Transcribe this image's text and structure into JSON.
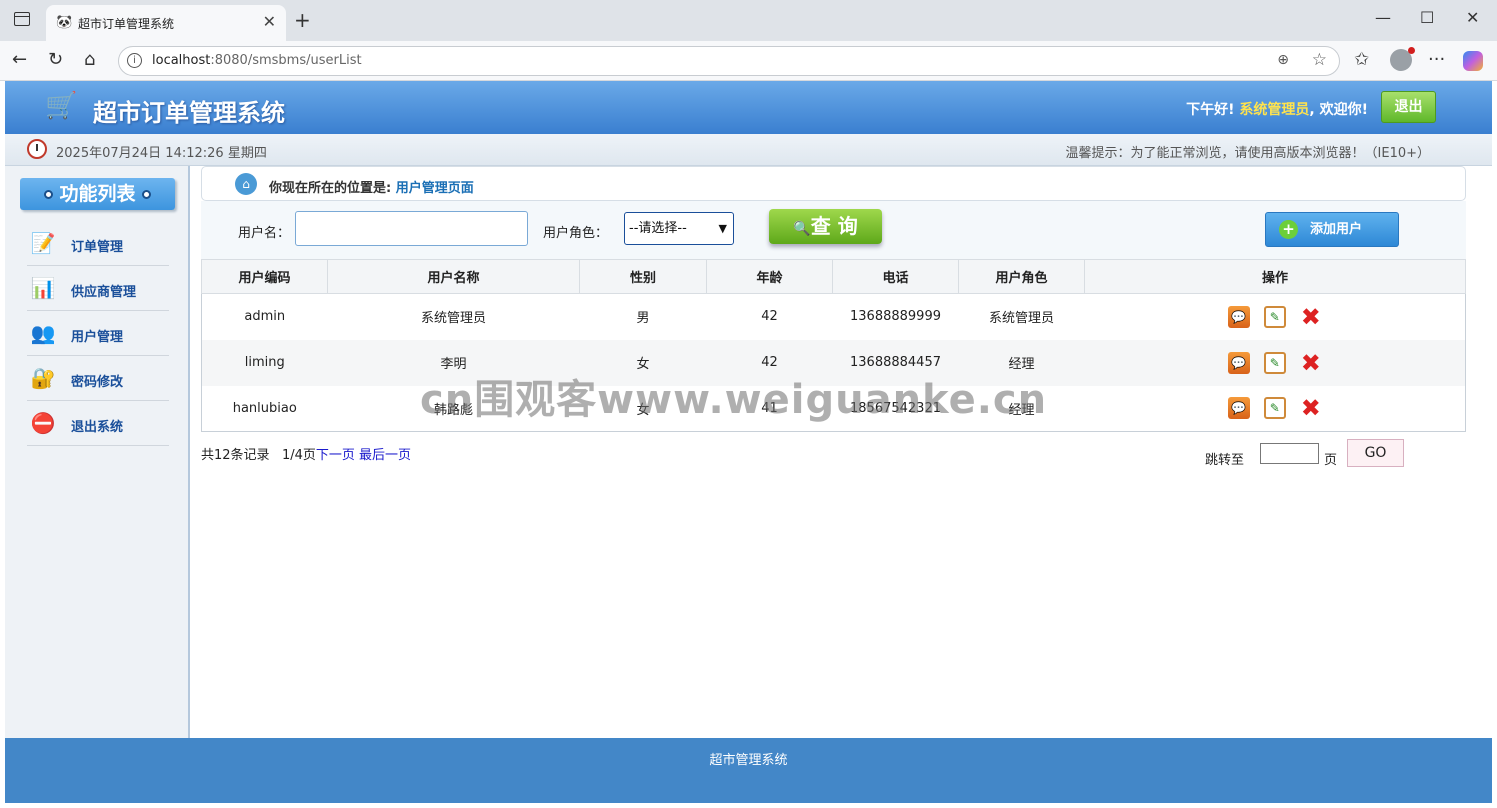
{
  "browser": {
    "tab_title": "超市订单管理系统",
    "url_host": "localhost",
    "url_rest": ":8080/smsbms/userList"
  },
  "header": {
    "title": "超市订单管理系统",
    "greeting": "下午好!",
    "username": "系统管理员",
    "welcome": ", 欢迎你!",
    "logout_label": "退出"
  },
  "timebar": {
    "datetime": "2025年07月24日 14:12:26 星期四",
    "tip": "温馨提示：为了能正常浏览，请使用高版本浏览器！（IE10+）"
  },
  "sidebar": {
    "title": "功能列表",
    "items": [
      {
        "label": "订单管理",
        "icon": "order-icon"
      },
      {
        "label": "供应商管理",
        "icon": "provider-icon"
      },
      {
        "label": "用户管理",
        "icon": "users-icon"
      },
      {
        "label": "密码修改",
        "icon": "password-icon"
      },
      {
        "label": "退出系统",
        "icon": "exit-icon"
      }
    ]
  },
  "location": {
    "prefix": "你现在所在的位置是:",
    "current": "用户管理页面"
  },
  "search": {
    "username_label": "用户名：",
    "username_value": "",
    "role_label": "用户角色：",
    "role_selected": "--请选择--",
    "query_label": "查 询",
    "add_label": "添加用户"
  },
  "table": {
    "headers": [
      "用户编码",
      "用户名称",
      "性别",
      "年龄",
      "电话",
      "用户角色",
      "操作"
    ],
    "rows": [
      {
        "code": "admin",
        "name": "系统管理员",
        "gender": "男",
        "age": "42",
        "phone": "13688889999",
        "role": "系统管理员"
      },
      {
        "code": "liming",
        "name": "李明",
        "gender": "女",
        "age": "42",
        "phone": "13688884457",
        "role": "经理"
      },
      {
        "code": "hanlubiao",
        "name": "韩路彪",
        "gender": "女",
        "age": "41",
        "phone": "18567542321",
        "role": "经理"
      }
    ]
  },
  "pager": {
    "total": "共12条记录",
    "page_info": "1/4页",
    "next": "下一页",
    "last": "最后一页",
    "jump_label": "跳转至",
    "jump_value": "",
    "page_unit": "页",
    "go_label": "GO"
  },
  "watermark": "cn围观客www.weiguanke.cn",
  "footer": {
    "text": "超市管理系统"
  },
  "colors": {
    "header_blue": "#3a7fd0",
    "footer_blue": "#4387c8",
    "query_green": "#5ea81a",
    "username_yellow": "#ffe34d"
  }
}
